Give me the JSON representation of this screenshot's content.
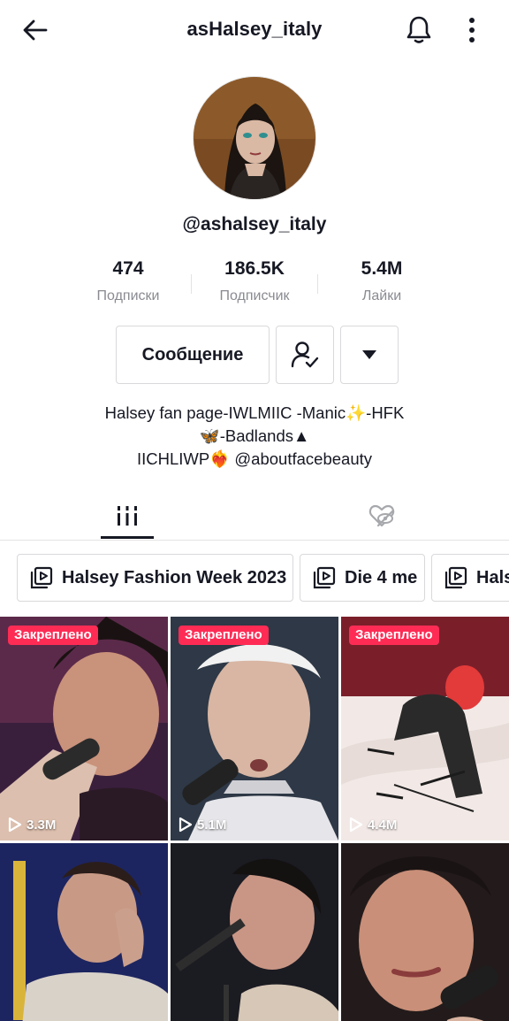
{
  "header": {
    "title": "asHalsey_italy",
    "back_icon": "arrow-left-icon",
    "bell_icon": "bell-icon",
    "more_icon": "more-vertical-icon"
  },
  "profile": {
    "username": "@ashalsey_italy",
    "stats": [
      {
        "value": "474",
        "label": "Подписки"
      },
      {
        "value": "186.5K",
        "label": "Подписчик"
      },
      {
        "value": "5.4M",
        "label": "Лайки"
      }
    ],
    "buttons": {
      "message_label": "Сообщение",
      "follow_icon": "user-check-icon",
      "more_icon": "caret-down-icon"
    },
    "bio": {
      "line1": "Halsey fan page-IWLMIIC -Manic✨-HFK",
      "line2": "🦋-Badlands▲",
      "line3": "IICHLIWP❤️‍🔥 @aboutfacebeauty"
    }
  },
  "tabs": {
    "videos_icon": "grid-bars-icon",
    "liked_icon": "heart-eye-slash-icon",
    "active": "videos"
  },
  "playlists": [
    {
      "label": "Halsey Fashion Week 2023"
    },
    {
      "label": "Die 4 me"
    },
    {
      "label": "Halsey"
    }
  ],
  "videos": [
    {
      "pinned_label": "Закреплено",
      "views": "3.3M"
    },
    {
      "pinned_label": "Закреплено",
      "views": "5.1M"
    },
    {
      "pinned_label": "Закреплено",
      "views": "4.4M"
    },
    {
      "pinned_label": "",
      "views": ""
    },
    {
      "pinned_label": "",
      "views": ""
    },
    {
      "pinned_label": "",
      "views": ""
    }
  ],
  "colors": {
    "accent": "#fe2c55",
    "text": "#161823",
    "secondary_text": "#8a8b91",
    "border": "#d9d9dc"
  }
}
